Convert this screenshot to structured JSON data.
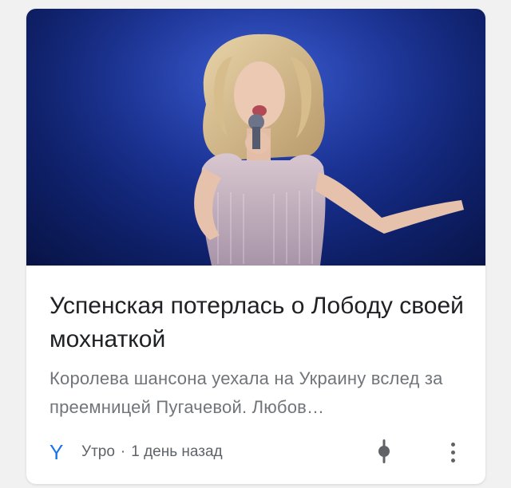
{
  "card": {
    "headline": "Успенская потерлась о Лободу своей мохнаткой",
    "snippet": "Королева шансона уехала на Украину вслед за преемницей Пугачевой. Любов…",
    "source": {
      "logo_letter": "Y",
      "name": "Утро",
      "separator": "·",
      "time": "1 день назад"
    },
    "image": {
      "subject": "singer-on-stage"
    },
    "colors": {
      "accent": "#1a73e8",
      "headline": "#202124",
      "snippet": "#70757a",
      "stage_blue": "#1a3399"
    },
    "icons": [
      "follow-pin-icon",
      "more-vert-icon"
    ]
  }
}
